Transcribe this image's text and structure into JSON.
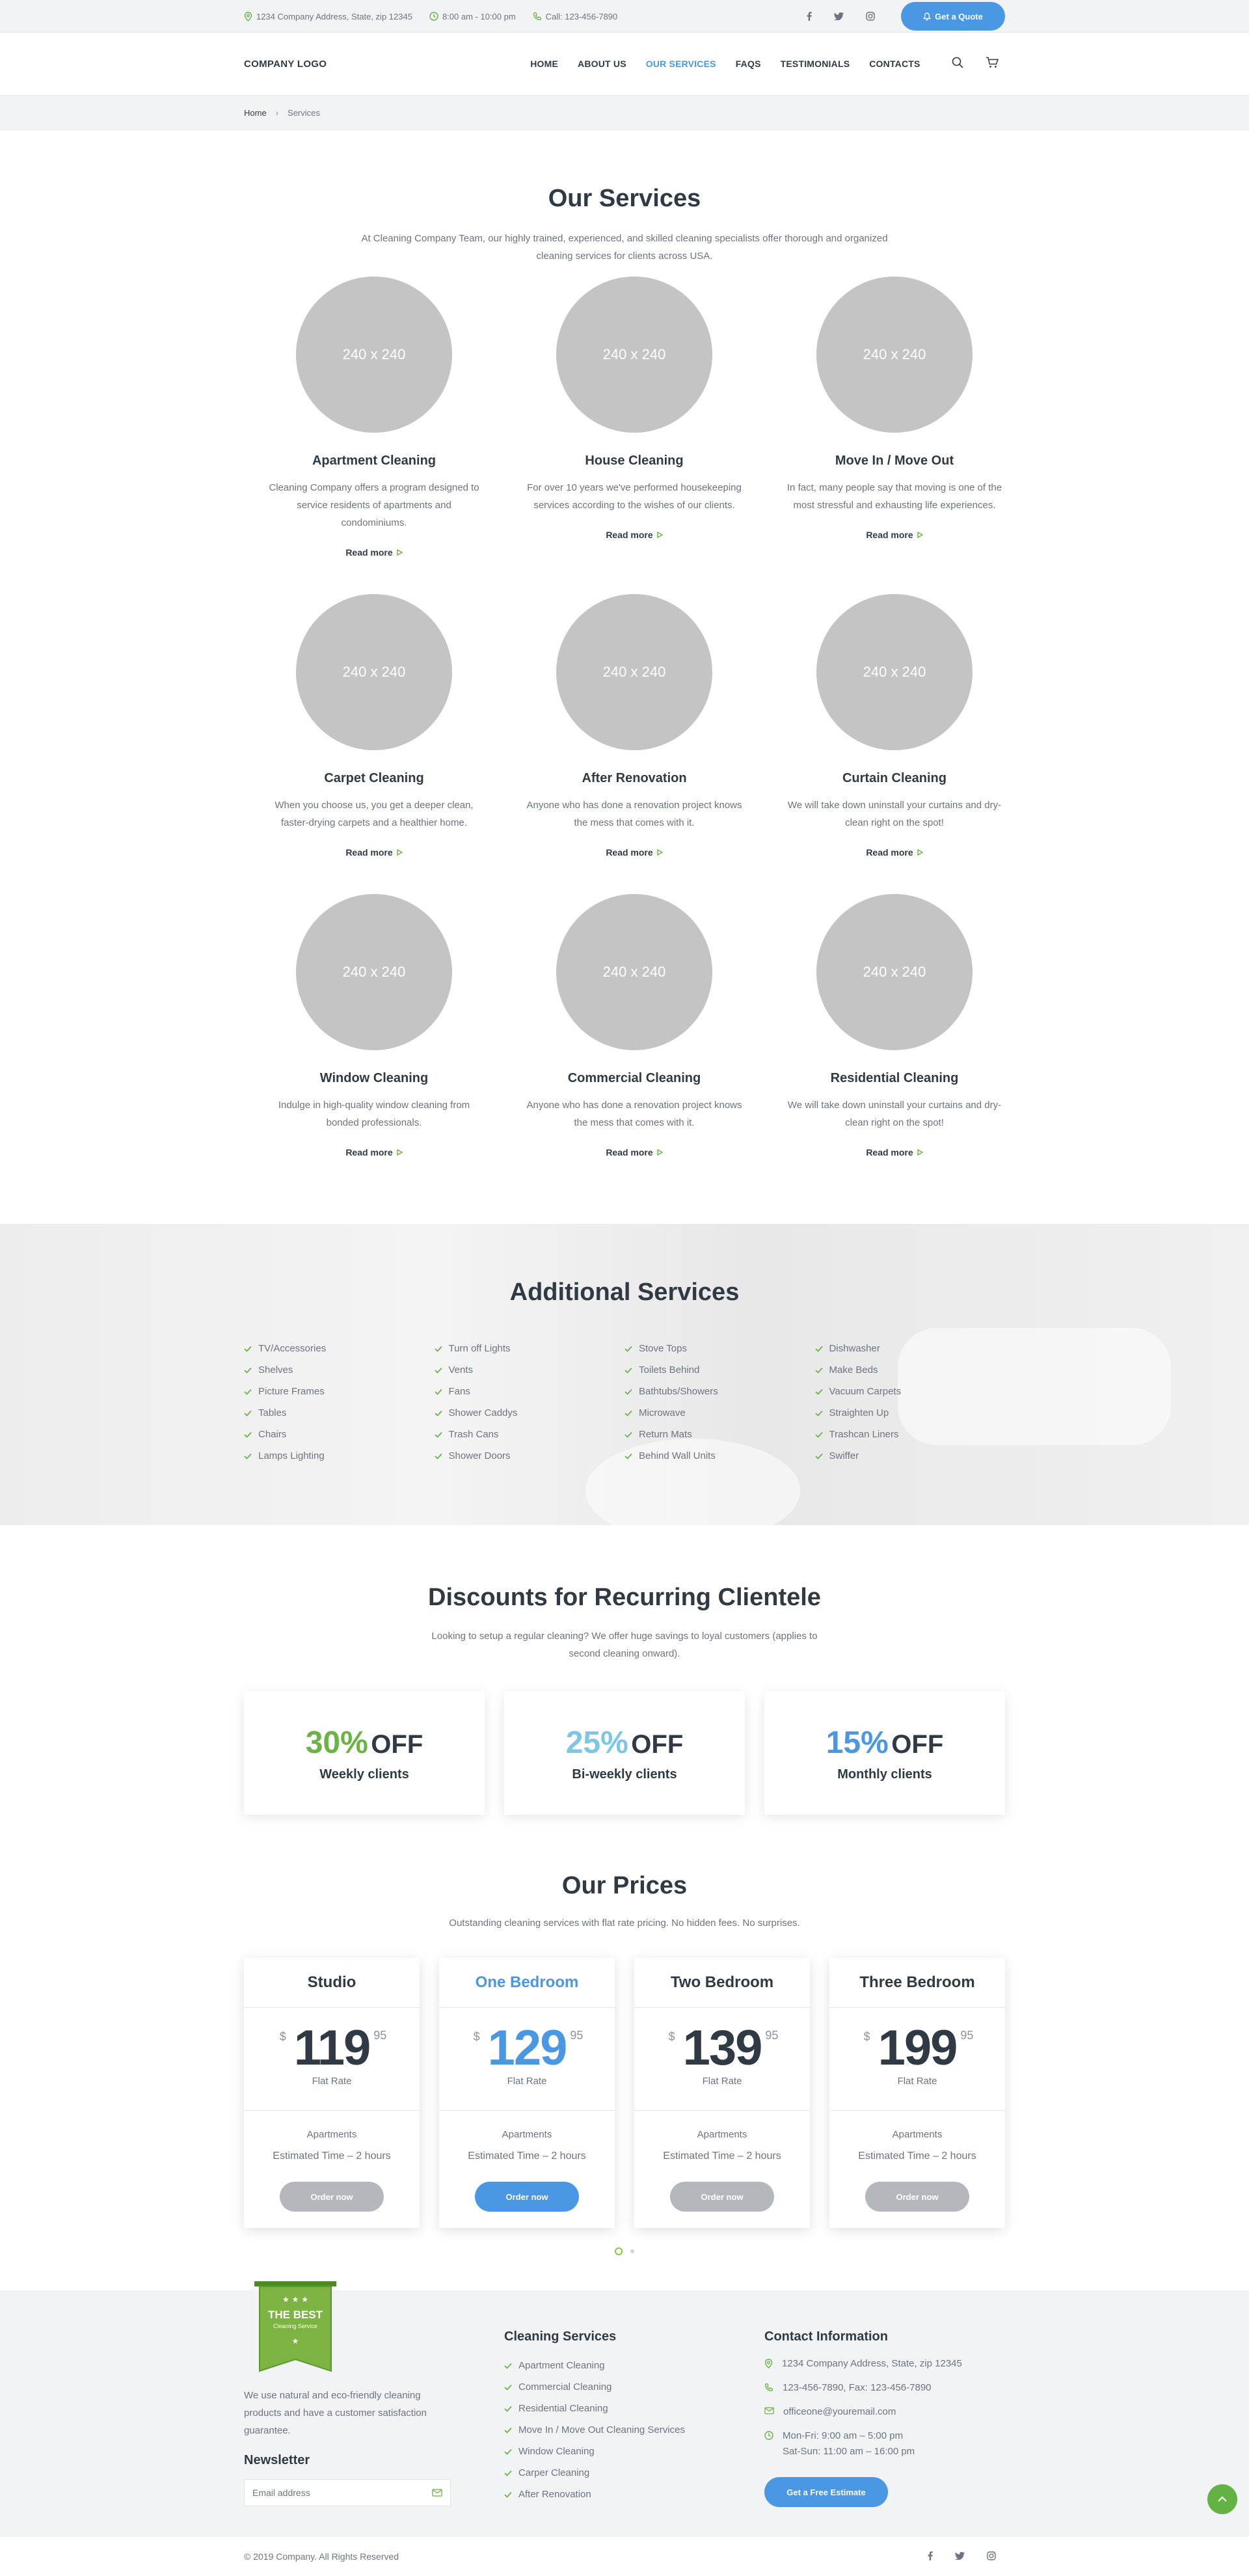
{
  "topbar": {
    "address": "1234 Company Address, State, zip 12345",
    "hours": "8:00 am - 10:00 pm",
    "call": "Call: 123-456-7890",
    "quote_label": "Get a Quote"
  },
  "header": {
    "logo": "COMPANY LOGO",
    "nav": [
      "HOME",
      "ABOUT US",
      "OUR SERVICES",
      "FAQS",
      "TESTIMONIALS",
      "CONTACTS"
    ],
    "active_nav": "OUR SERVICES"
  },
  "breadcrumb": {
    "home": "Home",
    "separator": "›",
    "current": "Services"
  },
  "services": {
    "title": "Our Services",
    "intro": "At Cleaning Company Team, our highly trained, experienced, and skilled cleaning specialists offer thorough and organized cleaning services for clients across USA.",
    "read_more": "Read more",
    "placeholder": "240 x 240",
    "items": [
      {
        "title": "Apartment Cleaning",
        "text": "Cleaning Company offers a program designed to service residents of apartments and condominiums."
      },
      {
        "title": "House Cleaning",
        "text": "For over 10 years we've performed housekeeping services according to the wishes of our clients."
      },
      {
        "title": "Move In / Move Out",
        "text": "In fact, many people say that moving is one of the most stressful and exhausting life experiences."
      },
      {
        "title": "Carpet Cleaning",
        "text": "When you choose us, you get a deeper clean, faster-drying carpets and a healthier home."
      },
      {
        "title": "After Renovation",
        "text": "Anyone who has done a renovation project knows the mess that comes with it."
      },
      {
        "title": "Curtain Cleaning",
        "text": "We will take down uninstall your curtains and dry-clean right on the spot!"
      },
      {
        "title": "Window Cleaning",
        "text": "Indulge in high-quality window cleaning from bonded professionals."
      },
      {
        "title": "Commercial Cleaning",
        "text": "Anyone who has done a renovation project knows the mess that comes with it."
      },
      {
        "title": "Residential Cleaning",
        "text": "We will take down uninstall your curtains and dry-clean right on the spot!"
      }
    ]
  },
  "additional": {
    "title": "Additional Services",
    "columns": [
      [
        "TV/Accessories",
        "Shelves",
        "Picture Frames",
        "Tables",
        "Chairs",
        "Lamps Lighting"
      ],
      [
        "Turn off Lights",
        "Vents",
        "Fans",
        "Shower Caddys",
        "Trash Cans",
        "Shower Doors"
      ],
      [
        "Stove Tops",
        "Toilets Behind",
        "Bathtubs/Showers",
        "Microwave",
        "Return Mats",
        "Behind Wall Units"
      ],
      [
        "Dishwasher",
        "Make Beds",
        "Vacuum Carpets",
        "Straighten Up",
        "Trashcan Liners",
        "Swiffer"
      ]
    ]
  },
  "discounts": {
    "title": "Discounts for Recurring Clientele",
    "intro": "Looking to setup a regular cleaning? We offer huge savings to loyal customers (applies to second cleaning onward).",
    "off_label": "OFF",
    "items": [
      {
        "percent": "30%",
        "label": "Weekly clients",
        "color": "#6ab344"
      },
      {
        "percent": "25%",
        "label": "Bi-weekly clients",
        "color": "#7cc7e2"
      },
      {
        "percent": "15%",
        "label": "Monthly clients",
        "color": "#4a97e3"
      }
    ]
  },
  "prices": {
    "title": "Our Prices",
    "intro": "Outstanding cleaning services with flat rate pricing. No hidden fees. No surprises.",
    "currency": "$",
    "flat_label": "Flat Rate",
    "button_label": "Order now",
    "plans": [
      {
        "name": "Studio",
        "price": "119",
        "cents": "95",
        "type": "Apartments",
        "time": "Estimated Time – 2 hours",
        "featured": false
      },
      {
        "name": "One Bedroom",
        "price": "129",
        "cents": "95",
        "type": "Apartments",
        "time": "Estimated Time – 2 hours",
        "featured": true
      },
      {
        "name": "Two Bedroom",
        "price": "139",
        "cents": "95",
        "type": "Apartments",
        "time": "Estimated Time – 2 hours",
        "featured": false
      },
      {
        "name": "Three Bedroom",
        "price": "199",
        "cents": "95",
        "type": "Apartments",
        "time": "Estimated Time – 2 hours",
        "featured": false
      }
    ]
  },
  "footer": {
    "badge_title": "THE BEST",
    "badge_sub": "Cleaning Service",
    "about": "We use natural and eco-friendly cleaning products and have a customer satisfaction guarantee.",
    "newsletter_title": "Newsletter",
    "email_placeholder": "Email address",
    "services_title": "Cleaning Services",
    "services": [
      "Apartment Cleaning",
      "Commercial Cleaning",
      "Residential Cleaning",
      "Move In / Move Out Cleaning Services",
      "Window Cleaning",
      "Carper Cleaning",
      "After Renovation"
    ],
    "contact_title": "Contact Information",
    "contact_address": "1234 Company Address, State, zip 12345",
    "contact_phone": "123-456-7890, Fax: 123-456-7890",
    "contact_email": "officeone@youremail.com",
    "contact_hours_1": "Mon-Fri: 9:00 am – 5:00 pm",
    "contact_hours_2": "Sat-Sun: 11:00 am – 16:00 pm",
    "estimate_label": "Get a Free Estimate",
    "copyright": "© 2019 Company. All Rights Reserved"
  },
  "colors": {
    "accent_blue": "#4a97e3",
    "accent_green": "#6ab344",
    "text_dark": "#2f3a45",
    "text_muted": "#6b7480"
  }
}
